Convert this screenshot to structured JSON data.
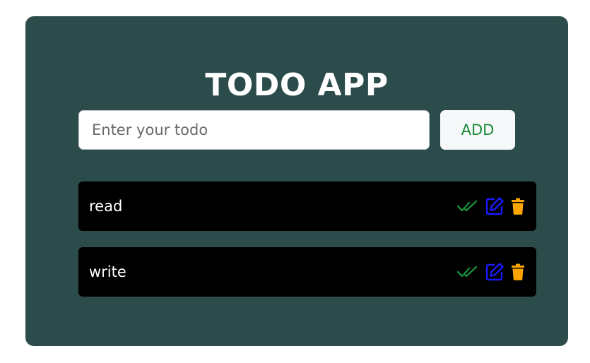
{
  "app": {
    "title": "TODO APP"
  },
  "form": {
    "input_placeholder": "Enter your todo",
    "input_value": "",
    "add_label": "ADD"
  },
  "todos": [
    {
      "text": "read"
    },
    {
      "text": "write"
    }
  ],
  "icons": {
    "complete": "double-check-icon",
    "edit": "edit-icon",
    "delete": "trash-icon"
  },
  "colors": {
    "card_background": "#2c4b4b",
    "item_background": "#000000",
    "complete_icon": "#198c3a",
    "edit_icon": "#1a1aff",
    "delete_icon": "#ffa500",
    "add_text": "#198c3a"
  }
}
